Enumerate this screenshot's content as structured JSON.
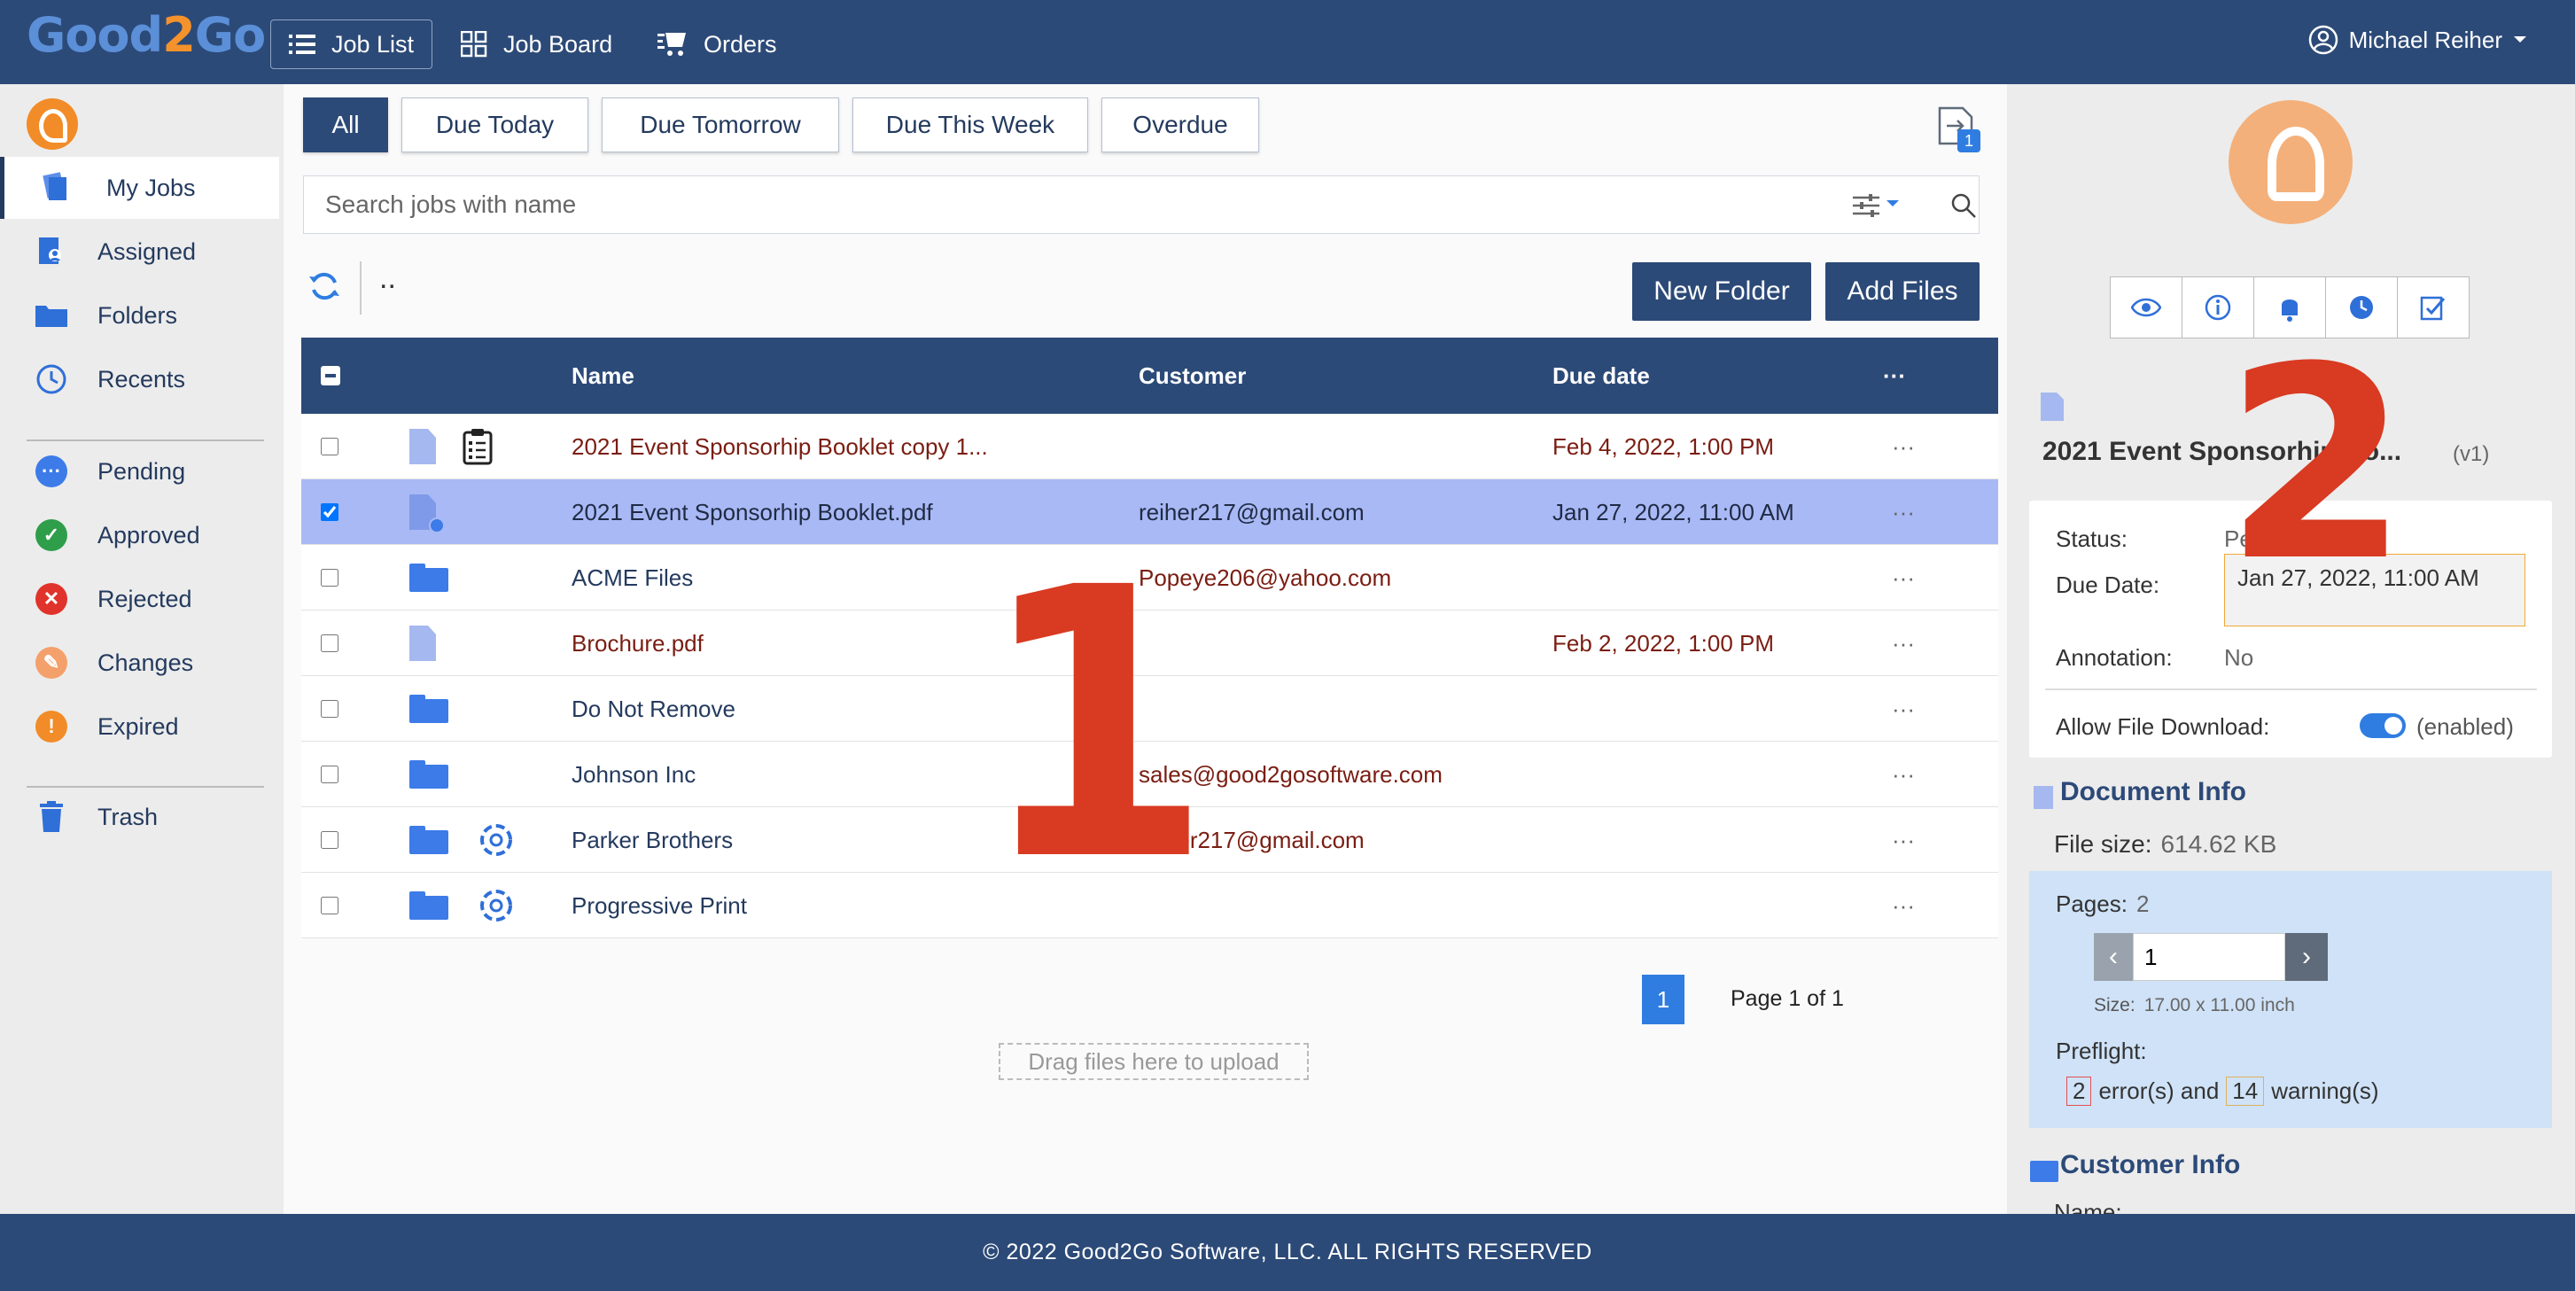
{
  "app": {
    "logo_part1": "Good",
    "logo_part2": "2",
    "logo_part3": "Go"
  },
  "topnav": {
    "job_list": "Job List",
    "job_board": "Job Board",
    "orders": "Orders",
    "user_name": "Michael Reiher"
  },
  "sidebar": {
    "my_jobs": "My Jobs",
    "assigned": "Assigned",
    "folders": "Folders",
    "recents": "Recents",
    "pending": "Pending",
    "approved": "Approved",
    "rejected": "Rejected",
    "changes": "Changes",
    "expired": "Expired",
    "trash": "Trash"
  },
  "filters": {
    "all": "All",
    "due_today": "Due Today",
    "due_tomorrow": "Due Tomorrow",
    "due_this_week": "Due This Week",
    "overdue": "Overdue"
  },
  "notification_count": "1",
  "search": {
    "placeholder": "Search jobs with name"
  },
  "toolbar": {
    "parent_dir": "..",
    "new_folder": "New Folder",
    "add_files": "Add Files"
  },
  "table": {
    "headers": {
      "name": "Name",
      "customer": "Customer",
      "due_date": "Due date",
      "more": "···"
    },
    "rows": [
      {
        "name": "2021 Event Sponsorhip Booklet copy 1...",
        "customer": "",
        "due": "Feb 4, 2022, 1:00 PM",
        "more": "···"
      },
      {
        "name": "2021 Event Sponsorhip Booklet.pdf",
        "customer": "reiher217@gmail.com",
        "due": "Jan 27, 2022, 11:00 AM",
        "more": "···"
      },
      {
        "name": "ACME Files",
        "customer": "Popeye206@yahoo.com",
        "due": "",
        "more": "···"
      },
      {
        "name": "Brochure.pdf",
        "customer": "",
        "due": "Feb 2, 2022, 1:00 PM",
        "more": "···"
      },
      {
        "name": "Do Not Remove",
        "customer": "",
        "due": "",
        "more": "···"
      },
      {
        "name": "Johnson Inc",
        "customer": "sales@good2gosoftware.com",
        "due": "",
        "more": "···"
      },
      {
        "name": "Parker Brothers",
        "customer": "reiher217@gmail.com",
        "due": "",
        "more": "···"
      },
      {
        "name": "Progressive Print",
        "customer": "",
        "due": "",
        "more": "···"
      }
    ]
  },
  "pagination": {
    "current": "1",
    "label": "Page 1 of 1"
  },
  "upload": {
    "drop_text": "Drag files here to upload"
  },
  "annotations": {
    "one": "1",
    "two": "2"
  },
  "details": {
    "title": "2021 Event Sponsorhip Bo...",
    "version": "(v1)",
    "status_label": "Status:",
    "status_value": "Pending",
    "due_label": "Due Date:",
    "due_value": "Jan 27, 2022, 11:00 AM",
    "annotation_label": "Annotation:",
    "annotation_value": "No",
    "download_label": "Allow File Download:",
    "download_state": "(enabled)",
    "doc_info_heading": "Document Info",
    "file_size_label": "File size:",
    "file_size_value": "614.62 KB",
    "pages_label": "Pages:",
    "pages_value": "2",
    "page_input_value": "1",
    "size_label": "Size:",
    "size_value": "17.00 x 11.00 inch",
    "preflight_label": "Preflight:",
    "errors_count": "2",
    "errors_text": "error(s) and",
    "warnings_count": "14",
    "warnings_text": "warning(s)",
    "customer_info_heading": "Customer Info",
    "customer_cut_text": "Name:"
  },
  "footer": {
    "copyright": "© 2022 Good2Go Software, LLC. ALL RIGHTS RESERVED"
  }
}
